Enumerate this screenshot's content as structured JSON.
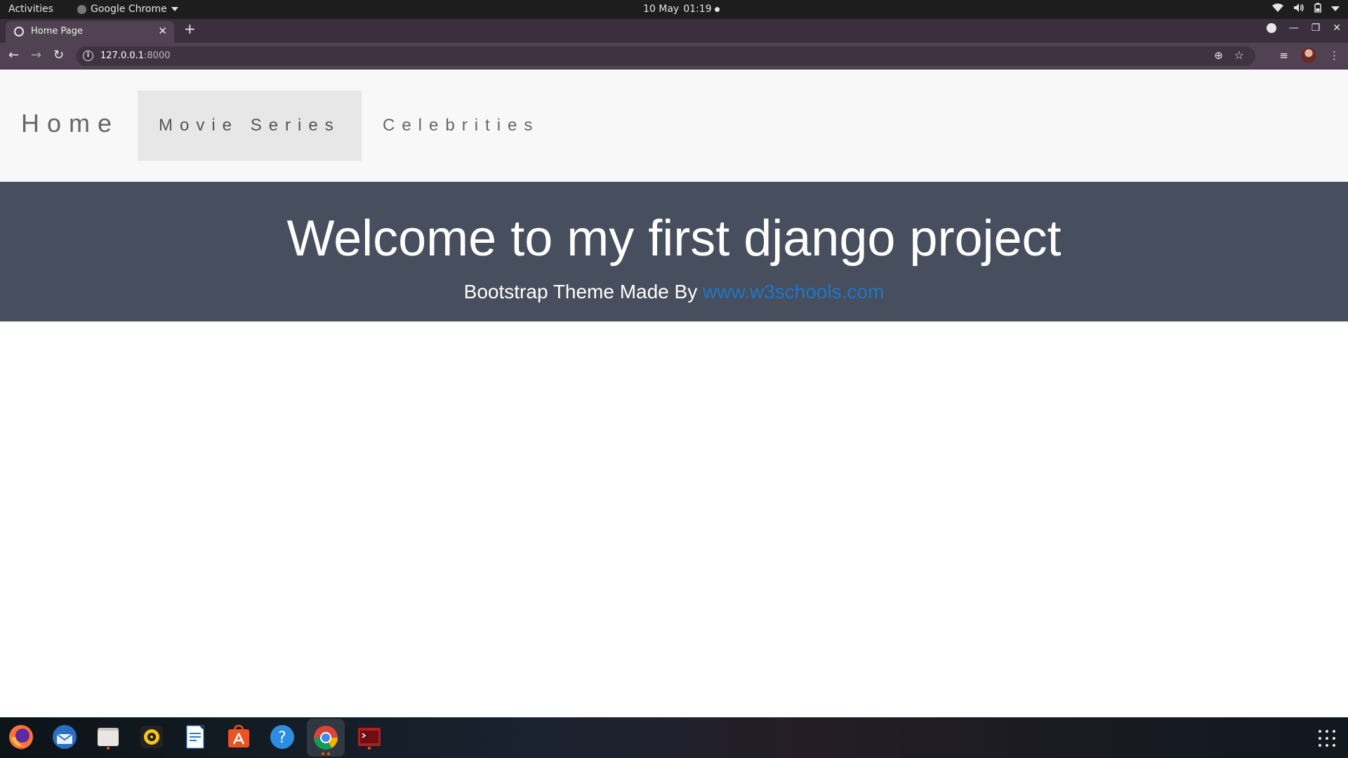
{
  "system_bar": {
    "activities": "Activities",
    "app_name": "Google Chrome",
    "date": "10 May",
    "time": "01:19"
  },
  "browser": {
    "tab_title": "Home Page",
    "url_host": "127.0.0.1",
    "url_port": ":8000",
    "new_tab_icon": "plus-icon"
  },
  "navbar": {
    "brand": "Home",
    "items": [
      {
        "label": "Movie Series",
        "active": true
      },
      {
        "label": "Celebrities",
        "active": false
      }
    ]
  },
  "hero": {
    "title": "Welcome to my first django project",
    "subtitle_prefix": "Bootstrap Theme Made By ",
    "link_text": "www.w3schools.com"
  },
  "dock": {
    "apps": [
      "firefox-icon",
      "thunderbird-icon",
      "files-icon",
      "rhythmbox-icon",
      "writer-icon",
      "software-icon",
      "help-icon",
      "chrome-icon",
      "terminal-icon"
    ]
  },
  "colors": {
    "hero_bg": "#474e5d",
    "link": "#1f77c6",
    "nav_bg": "#f8f8f8",
    "nav_active_bg": "#e7e7e7"
  }
}
